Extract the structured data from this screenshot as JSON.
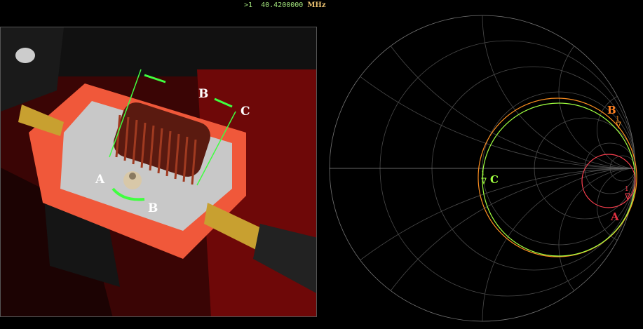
{
  "marker_readout": {
    "marker": ">1",
    "frequency": "40.4200000",
    "unit": "MHz"
  },
  "photo": {
    "labels": [
      "A",
      "B",
      "B",
      "C"
    ]
  },
  "smith_chart": {
    "traces": [
      {
        "name": "A",
        "color": "#ff4050",
        "marker": "1"
      },
      {
        "name": "B",
        "color": "#ff9020",
        "marker": "1"
      },
      {
        "name": "C",
        "color": "#a0ff40",
        "marker": "1"
      }
    ]
  }
}
